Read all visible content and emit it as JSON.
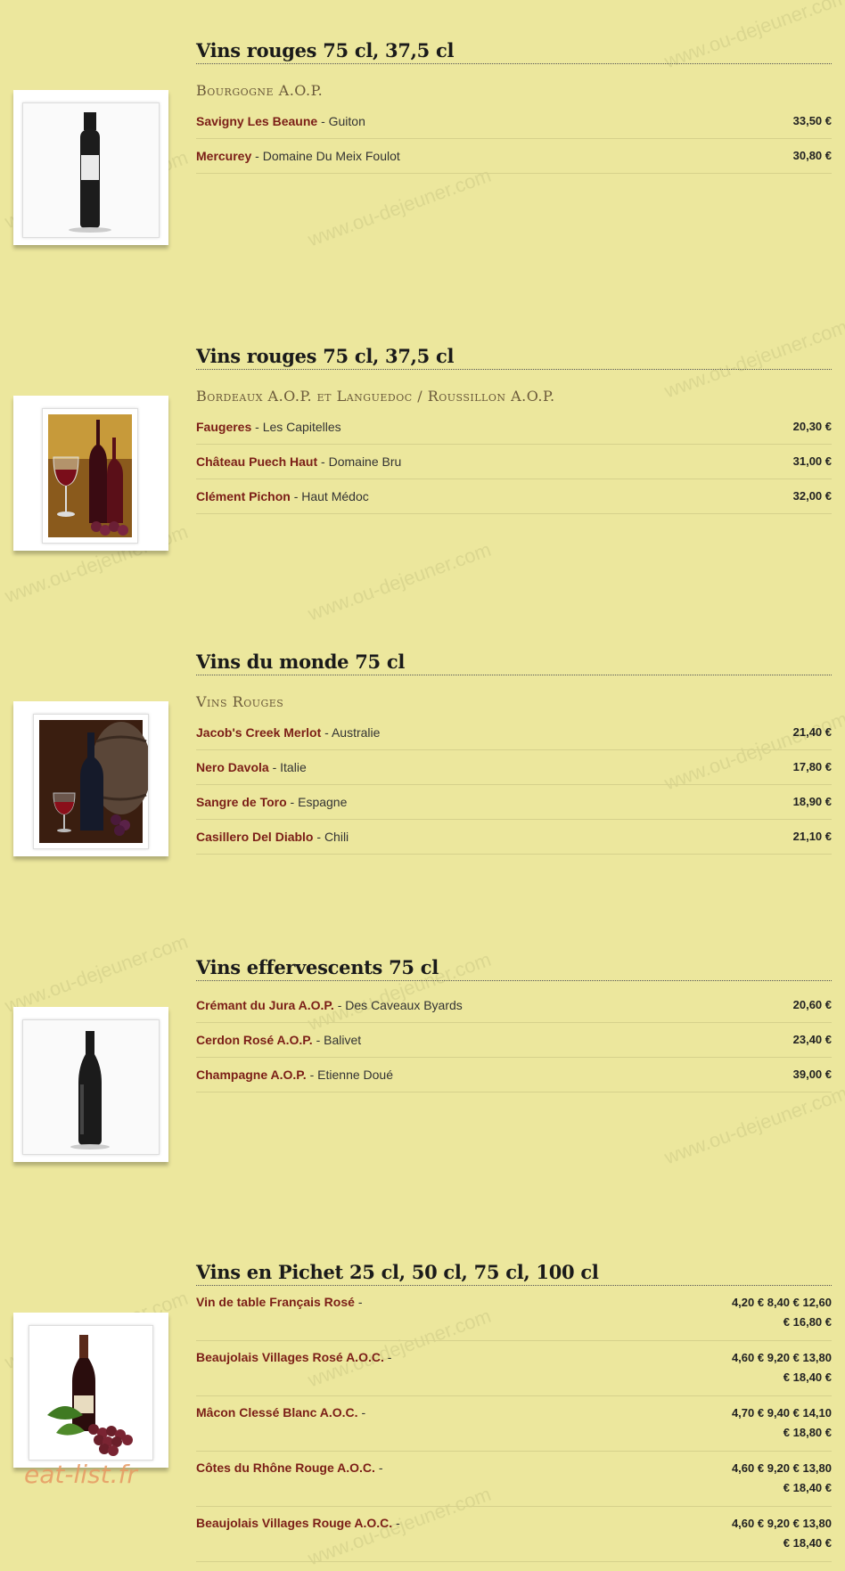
{
  "watermark": "www.ou-dejeuner.com",
  "logo": "eat-list.fr",
  "sections": [
    {
      "title": "Vins rouges 75 cl, 37,5 cl",
      "subtitle": "Bourgogne A.O.P.",
      "image_icon": "red-wine-bottle-icon",
      "items": [
        {
          "name": "Savigny Les Beaune",
          "desc": "Guiton",
          "price": "33,50 €"
        },
        {
          "name": "Mercurey",
          "desc": "Domaine Du Meix Foulot",
          "price": "30,80 €"
        }
      ]
    },
    {
      "title": "Vins rouges 75 cl, 37,5 cl",
      "subtitle": "Bordeaux A.O.P. et Languedoc / Roussillon A.O.P.",
      "image_icon": "wine-glass-and-bottles-icon",
      "items": [
        {
          "name": "Faugeres",
          "desc": "Les Capitelles",
          "price": "20,30 €"
        },
        {
          "name": "Château Puech Haut",
          "desc": "Domaine Bru",
          "price": "31,00 €"
        },
        {
          "name": "Clément Pichon",
          "desc": "Haut Médoc",
          "price": "32,00 €"
        }
      ]
    },
    {
      "title": "Vins du monde 75 cl",
      "subtitle": "Vins Rouges",
      "image_icon": "wine-barrel-and-bottle-icon",
      "items": [
        {
          "name": "Jacob's Creek Merlot",
          "desc": "Australie",
          "price": "21,40 €"
        },
        {
          "name": "Nero Davola",
          "desc": "Italie",
          "price": "17,80 €"
        },
        {
          "name": "Sangre de Toro",
          "desc": "Espagne",
          "price": "18,90 €"
        },
        {
          "name": "Casillero Del Diablo",
          "desc": "Chili",
          "price": "21,10 €"
        }
      ]
    },
    {
      "title": "Vins effervescents 75 cl",
      "subtitle": "",
      "image_icon": "dark-bottle-icon",
      "items": [
        {
          "name": "Crémant du Jura A.O.P.",
          "desc": "Des Caveaux Byards",
          "price": "20,60 €"
        },
        {
          "name": "Cerdon Rosé A.O.P.",
          "desc": "Balivet",
          "price": "23,40 €"
        },
        {
          "name": "Champagne A.O.P.",
          "desc": "Etienne Doué",
          "price": "39,00 €"
        }
      ]
    },
    {
      "title": "Vins en Pichet 25 cl, 50 cl, 75 cl, 100 cl",
      "subtitle": "",
      "image_icon": "bottle-with-grapes-icon",
      "items": [
        {
          "name": "Vin de table Français Rosé",
          "desc": "",
          "price_line1": "4,20 € 8,40 € 12,60",
          "price_line2": "€ 16,80 €"
        },
        {
          "name": "Beaujolais Villages Rosé A.O.C.",
          "desc": "",
          "price_line1": "4,60 € 9,20 € 13,80",
          "price_line2": "€ 18,40 €"
        },
        {
          "name": "Mâcon Clessé Blanc A.O.C.",
          "desc": "",
          "price_line1": "4,70 € 9,40 € 14,10",
          "price_line2": "€ 18,80 €"
        },
        {
          "name": "Côtes du Rhône Rouge A.O.C.",
          "desc": "",
          "price_line1": "4,60 € 9,20 € 13,80",
          "price_line2": "€ 18,40 €"
        },
        {
          "name": "Beaujolais Villages Rouge A.O.C.",
          "desc": "",
          "price_line1": "4,60 € 9,20 € 13,80",
          "price_line2": "€ 18,40 €"
        }
      ]
    }
  ]
}
